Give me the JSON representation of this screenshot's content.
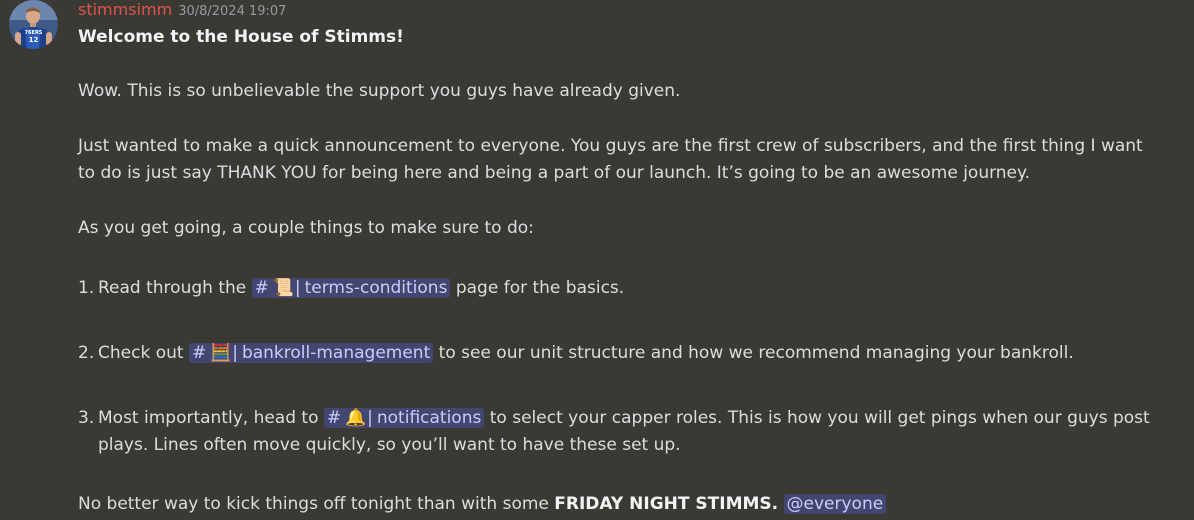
{
  "message": {
    "author": "stimmsimm",
    "timestamp": "30/8/2024 19:07",
    "title": "Welcome to the House of Stimms!",
    "p1": "Wow. This is so unbelievable the support you guys have already given.",
    "p2": "Just wanted to make a quick announcement to everyone. You guys are the first crew of subscribers, and the first thing I want to do is just say THANK YOU for being here and being a part of our launch. It’s going to be an awesome journey.",
    "p3": "As you get going, a couple things to make sure to do:",
    "items": [
      {
        "num": "1.",
        "before": "Read through the ",
        "channel_hash": "#",
        "channel_emoji": "📜",
        "channel_bar": "|",
        "channel_name": "terms-conditions",
        "after": " page for the basics."
      },
      {
        "num": "2.",
        "before": "Check out ",
        "channel_hash": "#",
        "channel_emoji": "🧮",
        "channel_bar": "|",
        "channel_name": "bankroll-management",
        "after": " to see our unit structure and how we recommend managing your bankroll."
      },
      {
        "num": "3.",
        "before": "Most importantly, head to ",
        "channel_hash": "#",
        "channel_emoji": "🔔",
        "channel_bar": "|",
        "channel_name": "notifications",
        "after": " to select your capper roles. This is how you will get pings when our guys post plays. Lines often move quickly, so you’ll want to have these set up."
      }
    ],
    "closing_before": "No better way to kick things off tonight than with some ",
    "closing_bold": "FRIDAY NIGHT STIMMS.",
    "closing_mention": "@everyone"
  },
  "avatar": {
    "jersey_text": "76ERS",
    "jersey_number": "12",
    "jersey_color": "#1d428a"
  },
  "colors": {
    "background": "#3a3934",
    "username": "#e0524b",
    "mention_text": "#c9cdfb",
    "mention_bg": "rgba(88,101,242,0.32)"
  }
}
